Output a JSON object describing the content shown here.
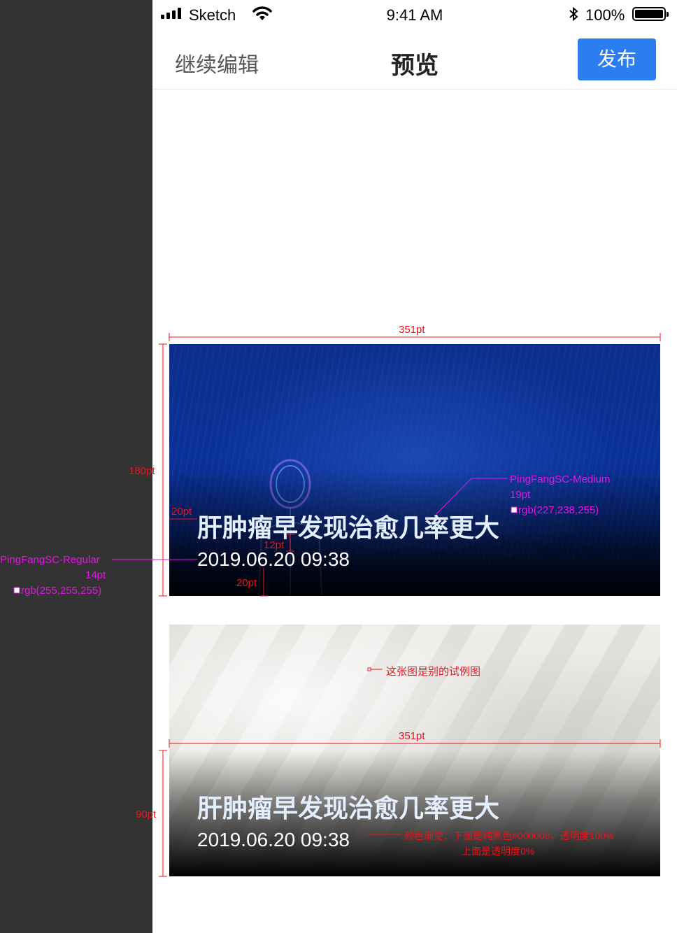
{
  "status_bar": {
    "carrier": "Sketch",
    "time": "9:41 AM",
    "battery_pct": "100%",
    "icons": [
      "signal-icon",
      "wifi-icon",
      "bluetooth-icon",
      "battery-icon"
    ]
  },
  "nav": {
    "back_label": "继续编辑",
    "title": "预览",
    "publish_label": "发布",
    "publish_color": "#2a7ef0"
  },
  "cards": [
    {
      "title": "肝肿瘤早发现治愈几率更大",
      "date": "2019.06.20 09:38"
    },
    {
      "title": "肝肿瘤早发现治愈几率更大",
      "date": "2019.06.20 09:38"
    }
  ],
  "annotations": {
    "card1_width": "351pt",
    "card1_height": "180pt",
    "title_left_padding": "20pt",
    "title_date_gap": "12pt",
    "date_bottom_padding": "20pt",
    "title_font": "PingFangSC-Medium",
    "title_size": "19pt",
    "title_color": "rgb(227,238,255)",
    "date_font": "PingFangSC-Regular",
    "date_size": "14pt",
    "date_color": "rgb(255,255,255)",
    "example_note": "这张图是别的试例图",
    "card2_width": "351pt",
    "gradient_height": "90pt",
    "gradient_note_1": "颜色渐变：下面是纯黑色#000000，透明度100%",
    "gradient_note_2": "上面是透明度0%"
  }
}
